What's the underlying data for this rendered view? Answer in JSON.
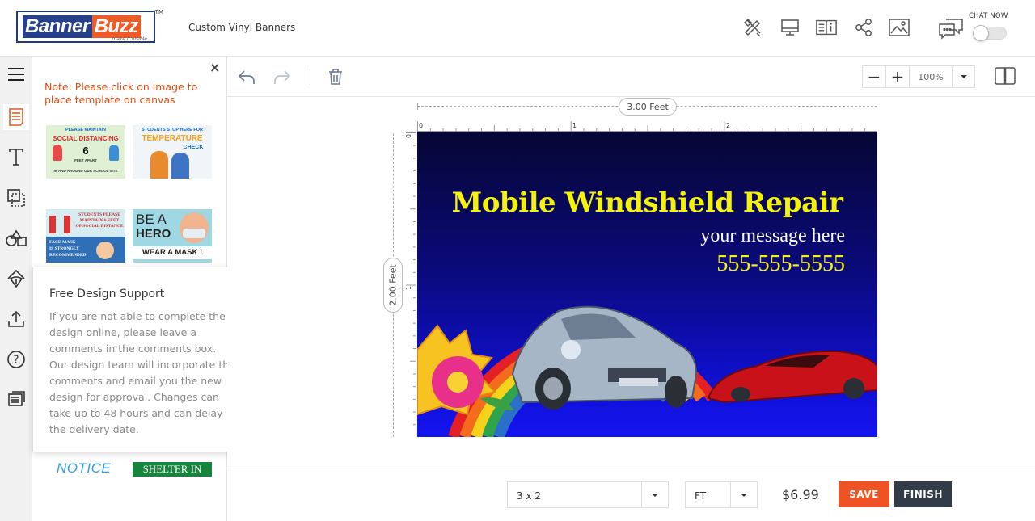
{
  "header": {
    "logo": {
      "part1": "Banner",
      "part2": "Buzz",
      "tagline": "make it visible",
      "tm": "TM"
    },
    "product_title": "Custom Vinyl Banners",
    "icons": [
      "design-tools-icon",
      "desktop-preview-icon",
      "product-info-icon",
      "share-icon",
      "image-icon",
      "chat-icon"
    ],
    "chat_label": "CHAT NOW",
    "chat_toggle_on": false
  },
  "rail": {
    "items": [
      "menu-icon",
      "templates-icon",
      "text-icon",
      "background-icon",
      "shapes-icon",
      "clipart-icon",
      "upload-icon",
      "help-icon",
      "comments-icon"
    ]
  },
  "template_panel": {
    "note": "Note: Please click on image to place template on canvas",
    "templates": [
      {
        "line1": "PLEASE MAINTAIN",
        "line2": "SOCIAL DISTANCING",
        "line3": "6",
        "line4": "FEET APART",
        "line5": "IN AND AROUND OUR SCHOOL SITE"
      },
      {
        "line1": "STUDENTS STOP HERE FOR",
        "line2": "TEMPERATURE",
        "line3": "CHECK"
      },
      {
        "line1": "STUDENTS PLEASE",
        "line2": "MAINTAIN 6 FEET",
        "line3": "OF SOCIAL DISTANCE",
        "line4": "FACE MASK",
        "line5": "IS STRONGLY",
        "line6": "RECOMMENDED"
      },
      {
        "line1": "BE A",
        "line2": "HERO",
        "line3": "WEAR A MASK !"
      }
    ],
    "notice_text": "NOTICE",
    "shelter_text": "SHELTER IN PLACE"
  },
  "popup": {
    "title": "Free Design Support",
    "body": "If you are not able to complete the design online, please leave a comments in the comments box. Our design team will incorporate the comments and email you the new design for approval. Changes can take up to 48 hours and can delay the delivery date."
  },
  "toolbar": {
    "zoom_value": "100%",
    "zoom_out": "−",
    "zoom_in": "+"
  },
  "canvas": {
    "width_label": "3.00 Feet",
    "height_label": "2.00 Feet",
    "ruler_top": [
      "0",
      "1",
      "2"
    ],
    "ruler_left": [
      "0",
      "1"
    ],
    "banner": {
      "title": "Mobile Windshield Repair",
      "message": "your message here",
      "phone": "555-555-5555"
    }
  },
  "bottom": {
    "size": "3 x 2",
    "unit": "FT",
    "price": "$6.99",
    "save_label": "SAVE",
    "finish_label": "FINISH"
  },
  "colors": {
    "brand_blue": "#25418e",
    "brand_orange": "#f15a24",
    "note_orange": "#e64b12",
    "save_button": "#f05323",
    "finish_button": "#323c49",
    "banner_title_yellow": "#f5f20a"
  }
}
